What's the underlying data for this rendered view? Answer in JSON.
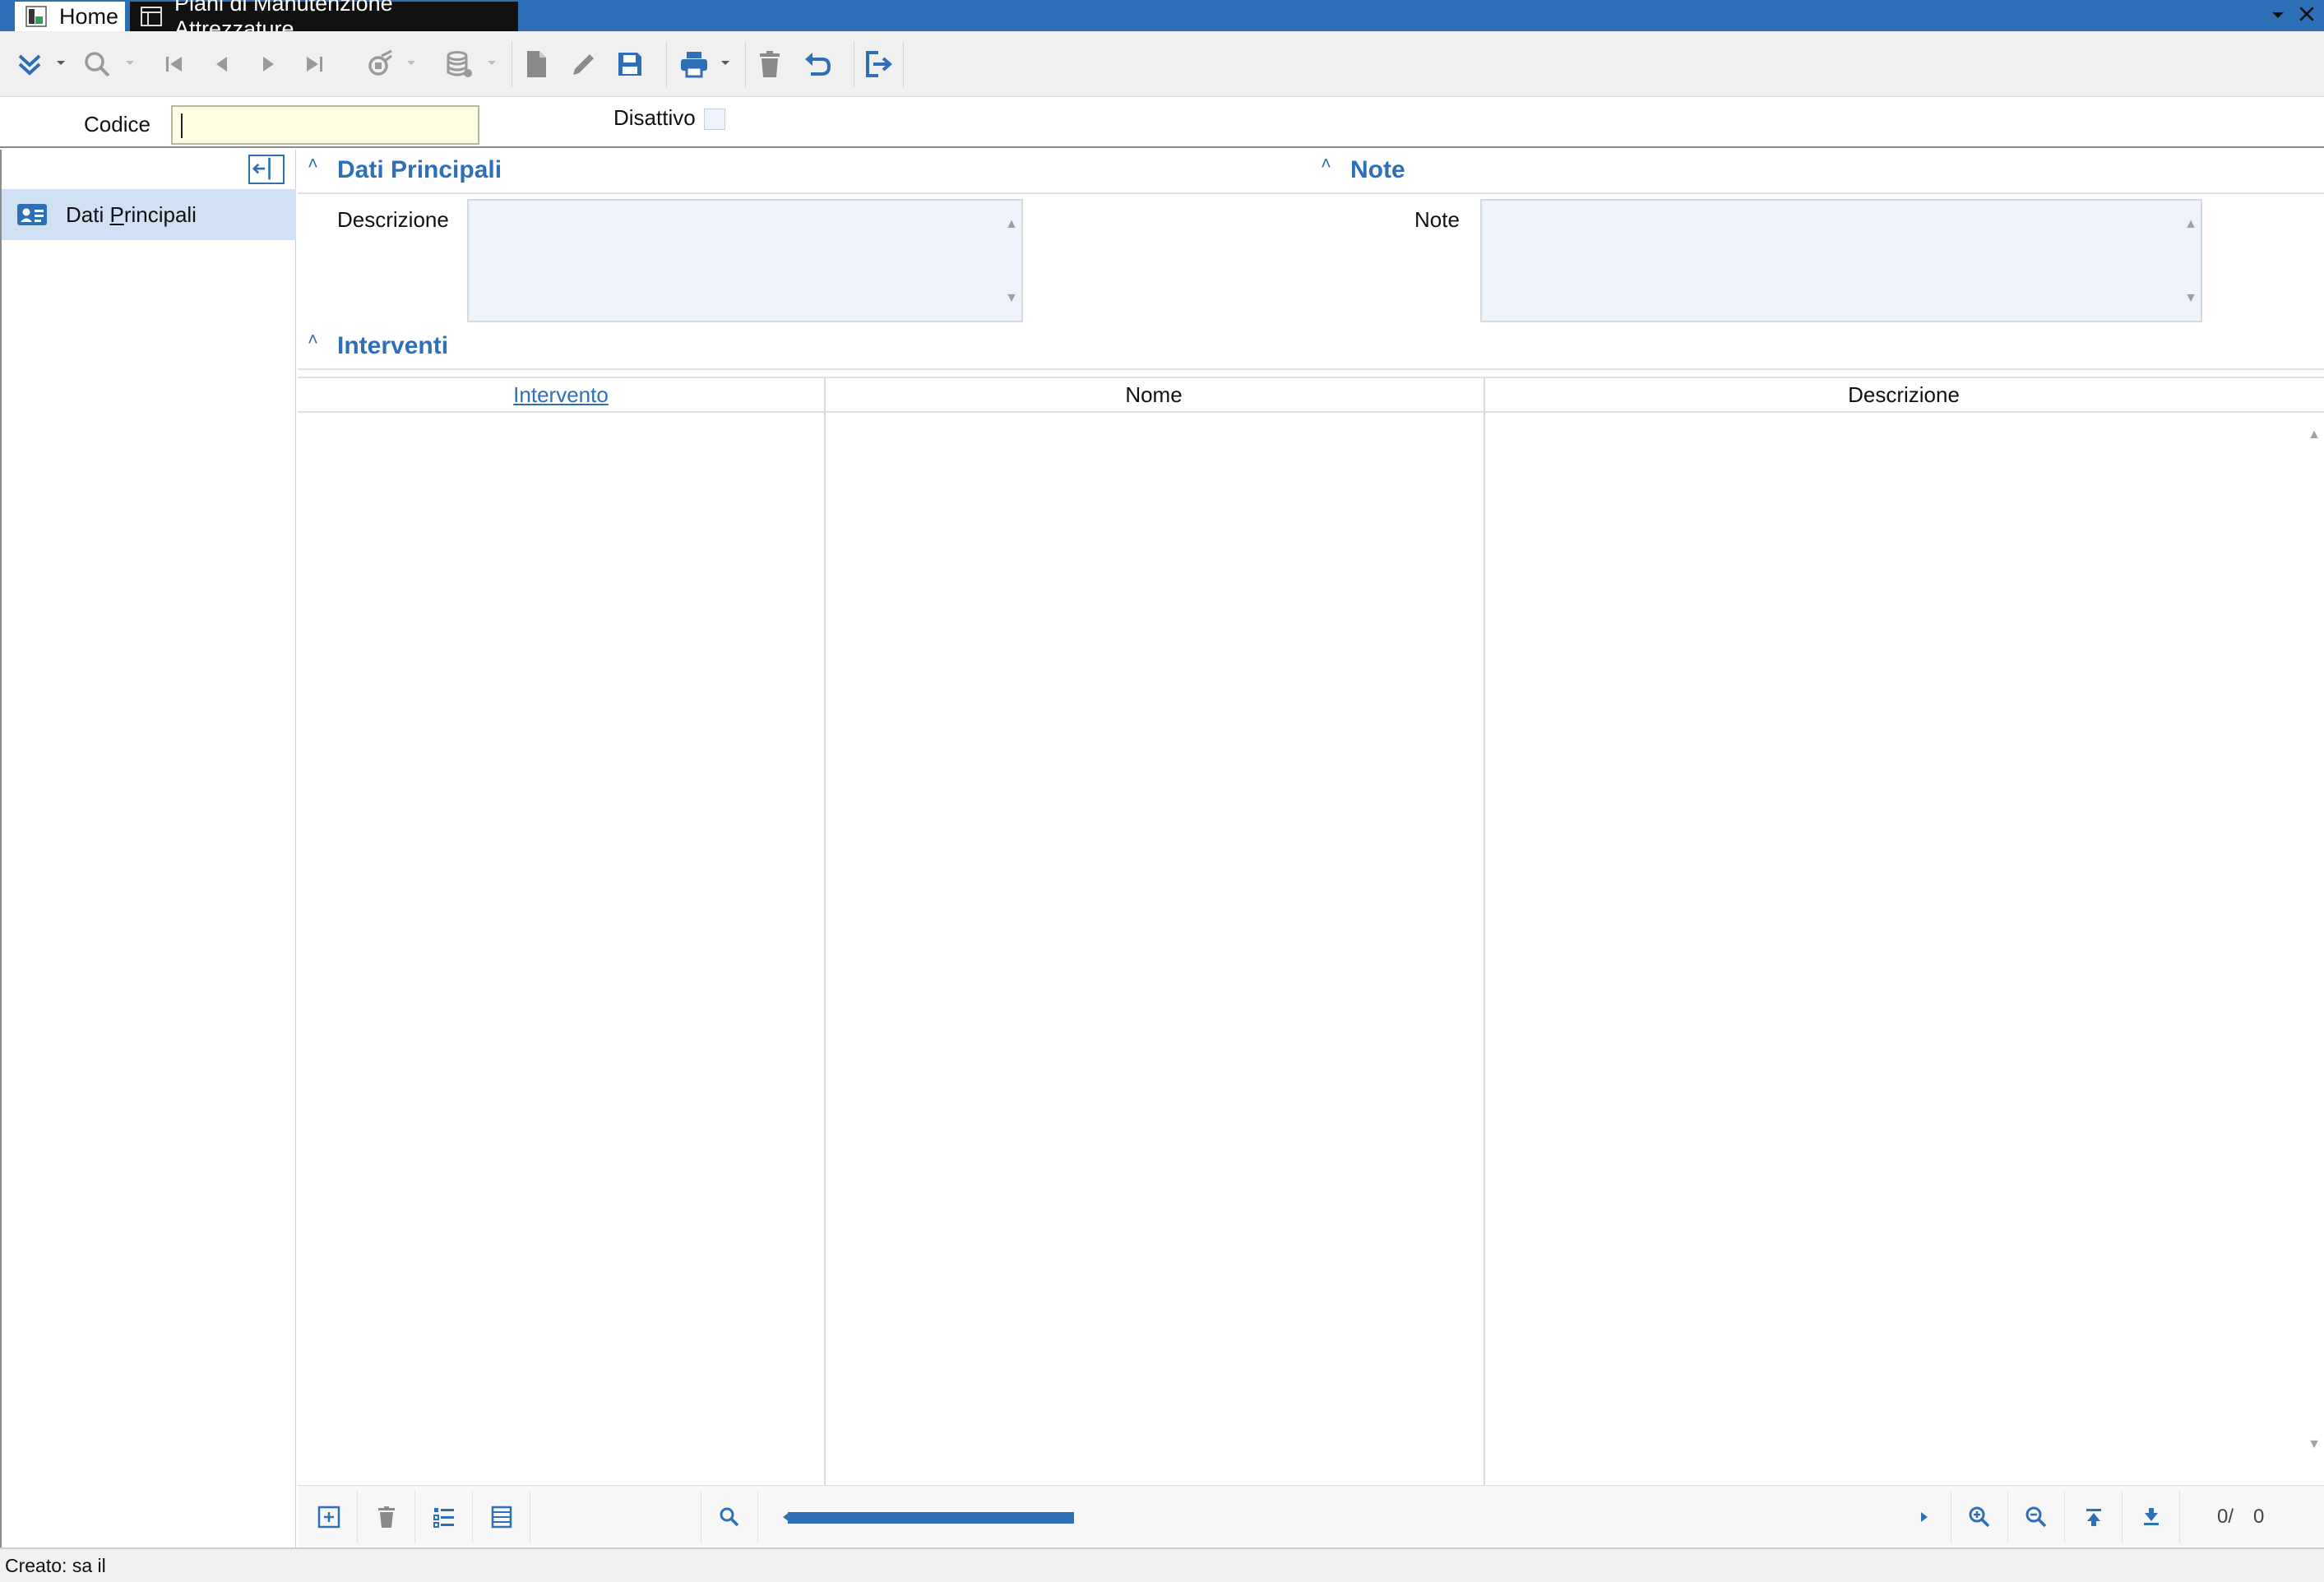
{
  "tabs": {
    "home": "Home",
    "form": "Piani di Manutenzione Attrezzature"
  },
  "header": {
    "codice_label": "Codice",
    "codice_value": "",
    "disattivo_label": "Disattivo",
    "disattivo_checked": false
  },
  "nav": {
    "items": [
      {
        "label_pre": "Dati ",
        "label_mnemonic": "P",
        "label_post": "rincipali"
      }
    ]
  },
  "sections": {
    "dati_principali": "Dati Principali",
    "note": "Note",
    "interventi": "Interventi"
  },
  "fields": {
    "descrizione_label": "Descrizione",
    "descrizione_value": "",
    "note_label": "Note",
    "note_value": ""
  },
  "grid": {
    "columns": [
      "Intervento",
      "Nome",
      "Descrizione"
    ],
    "rows": [],
    "counter_pos": "0/",
    "counter_total": "0"
  },
  "status": {
    "text": "Creato: sa il"
  },
  "colors": {
    "accent": "#2f6fb7",
    "titlebar": "#2f6fb7",
    "input_highlight": "#ffffe3",
    "nav_selected": "#cfe1f3",
    "field_bg": "#eef3fb"
  },
  "icons": {
    "toolbar": [
      "expand-double-chevron-icon",
      "search-icon",
      "first-record-icon",
      "prev-record-icon",
      "next-record-icon",
      "last-record-icon",
      "edit-query-icon",
      "database-icon",
      "new-document-icon",
      "edit-pencil-icon",
      "save-icon",
      "print-icon",
      "delete-trash-icon",
      "undo-icon",
      "exit-icon"
    ],
    "grid_footer": [
      "add-row-icon",
      "delete-row-icon",
      "list-detail-icon",
      "list-view-icon",
      "search-icon",
      "zoom-in-icon",
      "zoom-out-icon",
      "scroll-top-icon",
      "scroll-bottom-icon"
    ]
  }
}
